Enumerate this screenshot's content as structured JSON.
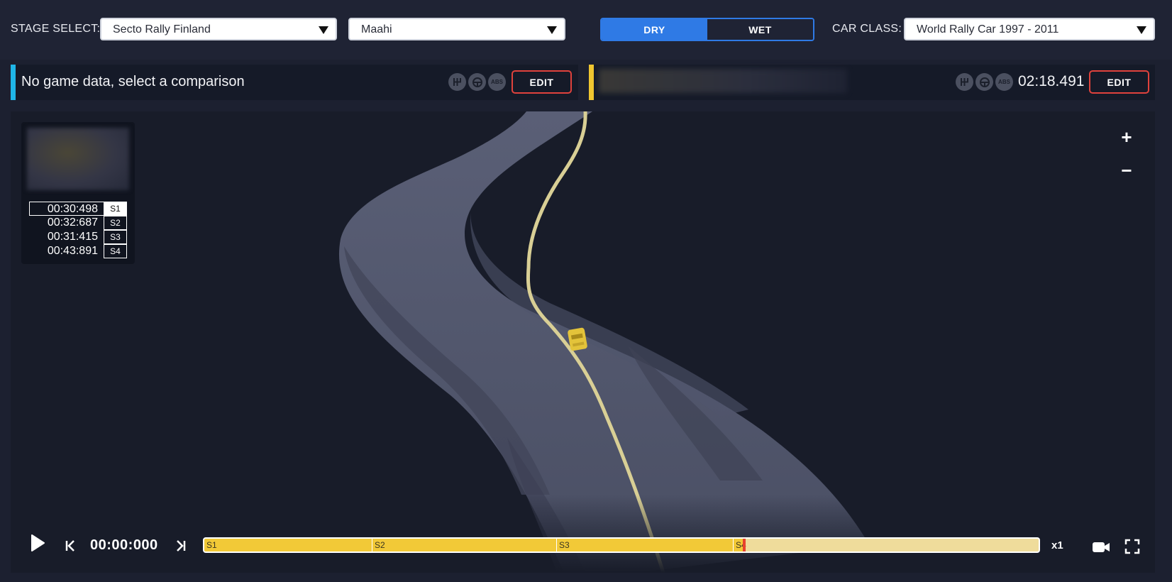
{
  "header": {
    "stage_label": "STAGE SELECT:",
    "rally": "Secto Rally Finland",
    "stage": "Maahi",
    "surface": {
      "dry": "DRY",
      "wet": "WET",
      "selected": "DRY"
    },
    "car_class_label": "CAR CLASS:",
    "car_class": "World Rally Car 1997 - 2011"
  },
  "comparison_left": {
    "message": "No game data, select a comparison",
    "edit_label": "EDIT",
    "accent_color": "#1fb6e8",
    "assists": [
      "gearbox-icon",
      "steering-icon",
      "abs-icon"
    ],
    "abs_text": "ABS"
  },
  "comparison_right": {
    "time": "02:18.491",
    "edit_label": "EDIT",
    "accent_color": "#f0c630",
    "assists": [
      "gearbox-icon",
      "steering-icon",
      "abs-icon"
    ],
    "abs_text": "ABS"
  },
  "splits": [
    {
      "time": "00:30:498",
      "sector": "S1",
      "active": true
    },
    {
      "time": "00:32:687",
      "sector": "S2",
      "active": false
    },
    {
      "time": "00:31:415",
      "sector": "S3",
      "active": false
    },
    {
      "time": "00:43:891",
      "sector": "S4",
      "active": false
    }
  ],
  "zoom": {
    "in": "+",
    "out": "−"
  },
  "playback": {
    "current_time": "00:00:000",
    "speed": "x1",
    "progress_fraction": 0.647,
    "sectors": [
      "S1",
      "S2",
      "S3",
      "S4"
    ]
  }
}
